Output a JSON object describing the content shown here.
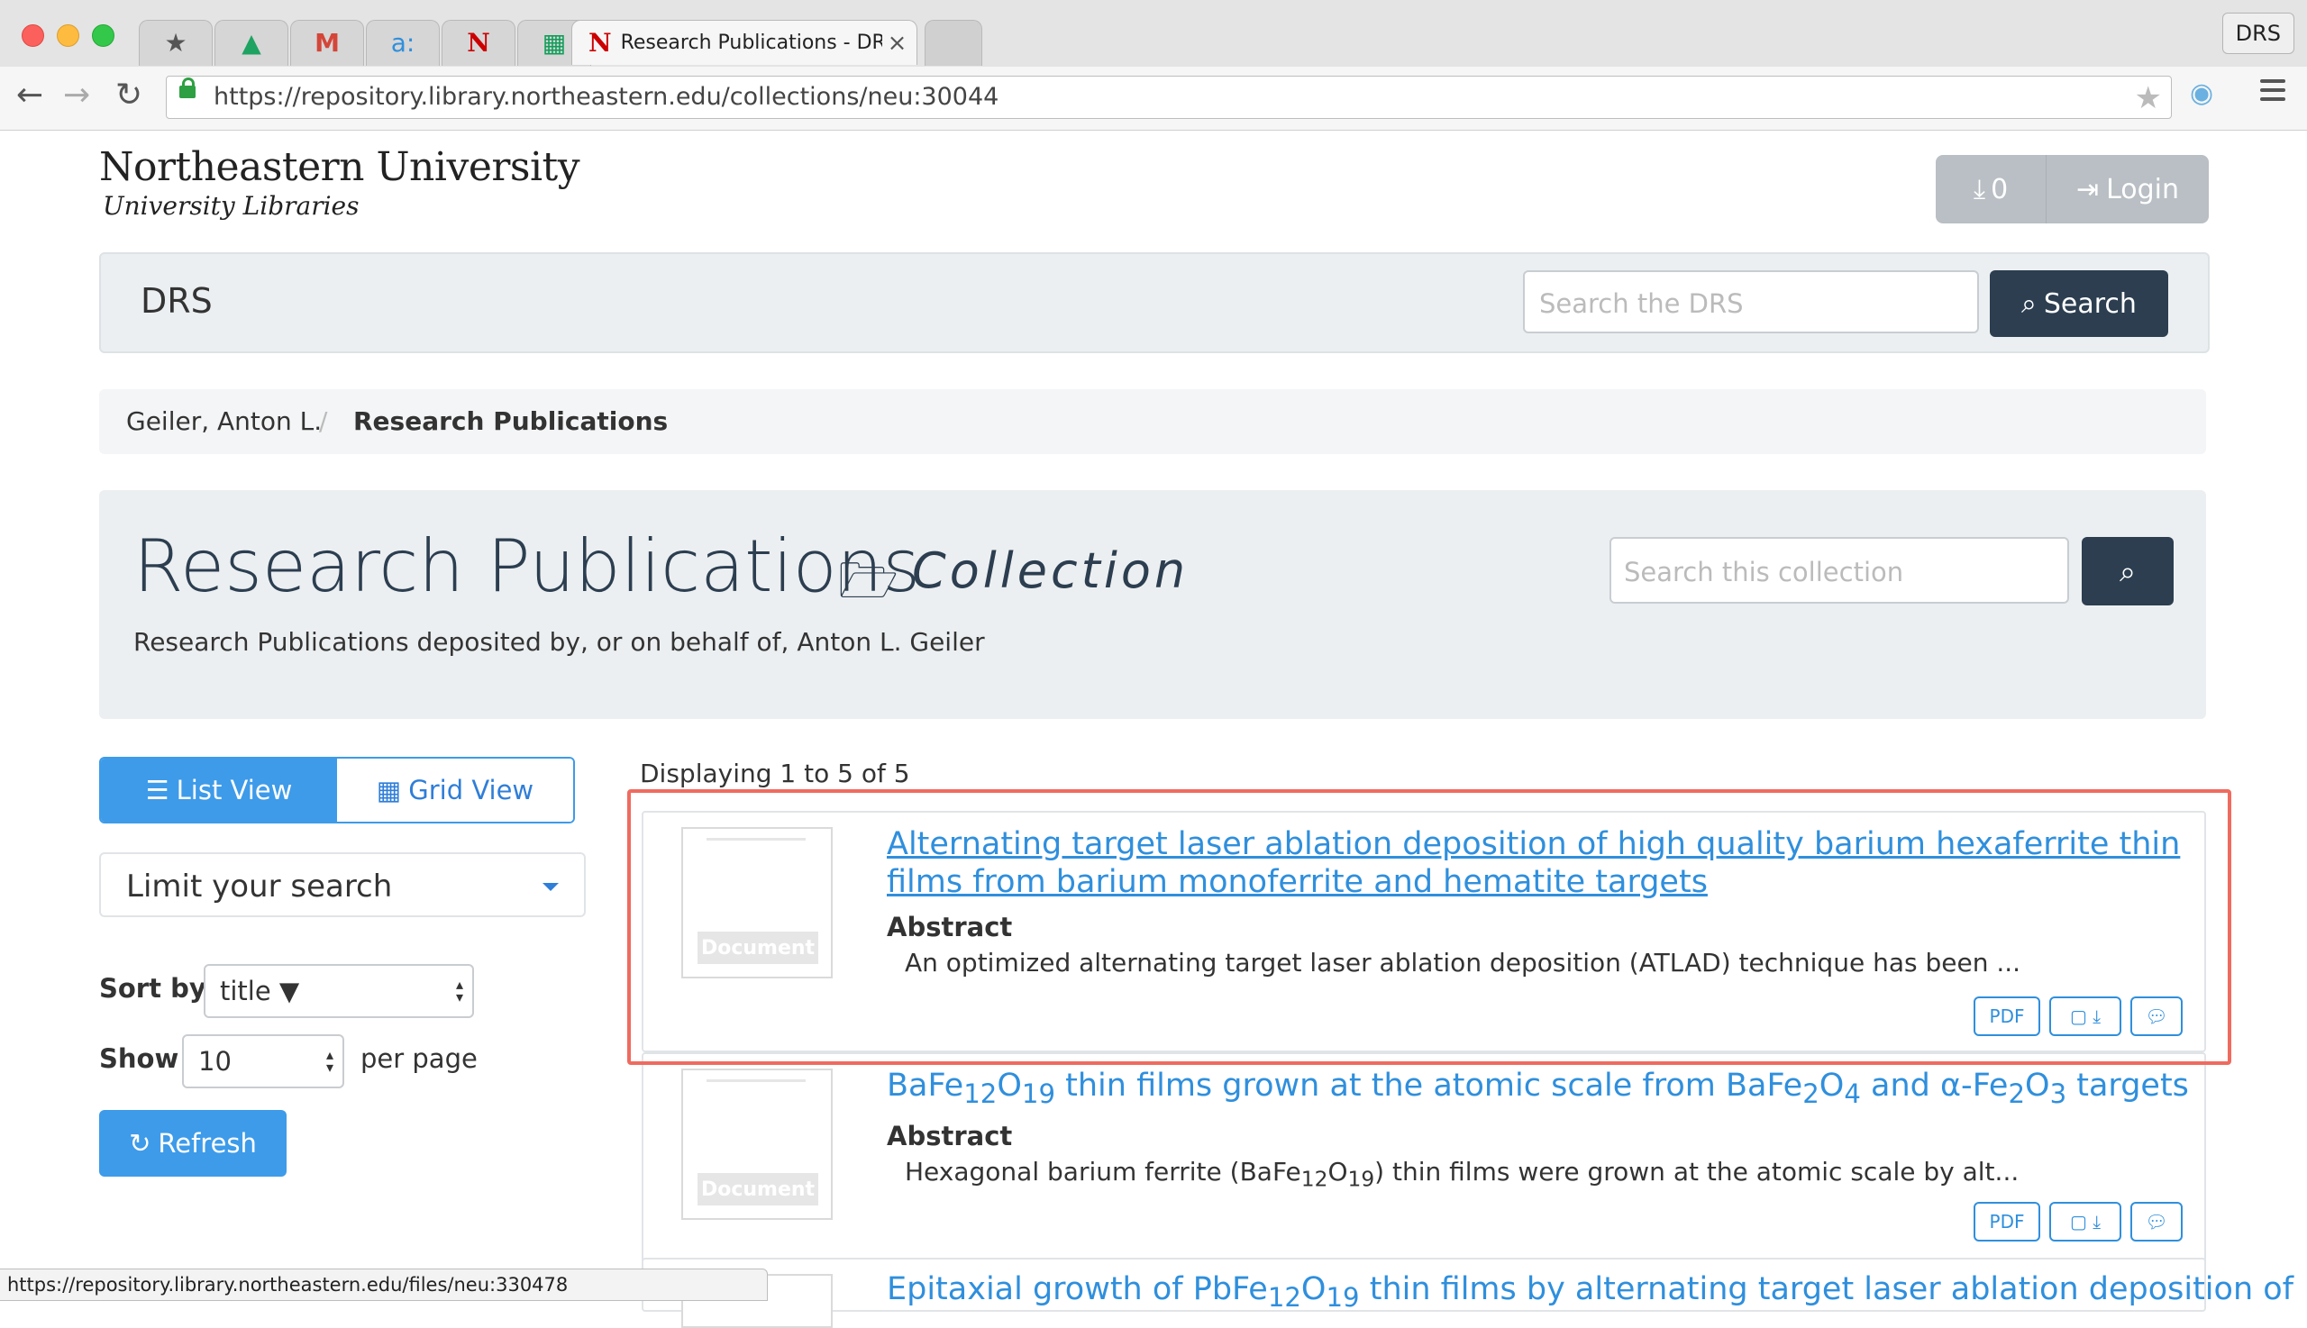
{
  "browser": {
    "tabs": [
      {
        "icon": "★"
      },
      {
        "icon": "▲"
      },
      {
        "icon": "M"
      },
      {
        "icon": "a:"
      },
      {
        "icon": "N"
      },
      {
        "icon": "▦"
      },
      {
        "icon": "N",
        "title": "Research Publications - DRS",
        "active": true
      }
    ],
    "profile": "DRS",
    "url": "https://repository.library.northeastern.edu/collections/neu:30044",
    "status_url": "https://repository.library.northeastern.edu/files/neu:330478"
  },
  "header": {
    "logo_main": "Northeastern University",
    "logo_sub": "University Libraries",
    "download_count": "0",
    "login_label": "Login"
  },
  "drs_bar": {
    "brand": "DRS",
    "search_placeholder": "Search the DRS",
    "search_button": "Search"
  },
  "breadcrumb": {
    "items": [
      "Geiler, Anton L.",
      "Research Publications"
    ],
    "separator": "/"
  },
  "collection": {
    "title": "Research Publications",
    "type_label": "Collection",
    "description": "Research Publications deposited by, or on behalf of, Anton L. Geiler",
    "search_placeholder": "Search this collection"
  },
  "sidebar": {
    "list_view": "List View",
    "grid_view": "Grid View",
    "limit_label": "Limit your search",
    "sort_label": "Sort by",
    "sort_value": "title ▼",
    "show_label": "Show",
    "show_value": "10",
    "per_page": "per page",
    "refresh": "Refresh"
  },
  "results": {
    "displaying": "Displaying 1 to 5 of 5",
    "items": [
      {
        "title": "Alternating target laser ablation deposition of high quality barium hexaferrite thin films from barium monoferrite and hematite targets",
        "abstract_label": "Abstract",
        "abstract": "An optimized alternating target laser ablation deposition (ATLAD) technique has been ...",
        "badge": "Document",
        "pdf": "PDF"
      },
      {
        "title_parts": [
          "BaFe",
          "12",
          "O",
          "19",
          " thin films grown at the atomic scale from BaFe",
          "2",
          "O",
          "4",
          " and α-Fe",
          "2",
          "O",
          "3",
          " targets"
        ],
        "abstract_label": "Abstract",
        "abstract_parts": [
          "Hexagonal barium ferrite (BaFe",
          "12",
          "O",
          "19",
          ") thin films were grown at the atomic scale by alt..."
        ],
        "badge": "Document",
        "pdf": "PDF"
      },
      {
        "title_parts": [
          "Epitaxial growth of PbFe",
          "12",
          "O",
          "19",
          " thin films by alternating target laser ablation deposition of"
        ]
      }
    ]
  },
  "colors": {
    "primary": "#3d9be9",
    "dark": "#2c3e50",
    "link": "#2f8fdd",
    "highlight": "#ef6b5f"
  }
}
